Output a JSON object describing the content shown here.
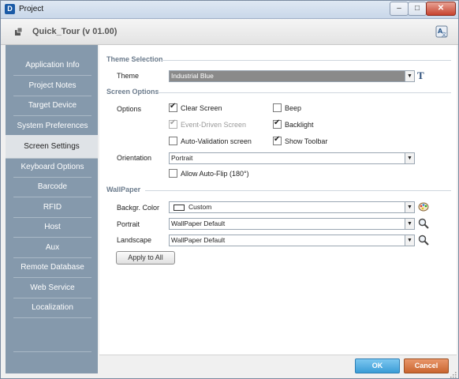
{
  "window": {
    "title": "Project",
    "app_icon_letter": "D",
    "minimize": "–",
    "maximize": "□",
    "close": "✕"
  },
  "header": {
    "project_name": "Quick_Tour (v 01.00)"
  },
  "sidebar": {
    "items": [
      {
        "label": "Application Info"
      },
      {
        "label": "Project Notes"
      },
      {
        "label": "Target Device"
      },
      {
        "label": "System Preferences"
      },
      {
        "label": "Screen Settings",
        "active": true
      },
      {
        "label": "Keyboard Options"
      },
      {
        "label": "Barcode"
      },
      {
        "label": "RFID"
      },
      {
        "label": "Host"
      },
      {
        "label": "Aux"
      },
      {
        "label": "Remote Database"
      },
      {
        "label": "Web Service"
      },
      {
        "label": "Localization"
      }
    ]
  },
  "theme_selection": {
    "section_title": "Theme Selection",
    "theme_label": "Theme",
    "theme_value": "Industrial Blue",
    "font_button_glyph": "T"
  },
  "screen_options": {
    "section_title": "Screen Options",
    "options_label": "Options",
    "checkboxes": {
      "clear_screen": {
        "label": "Clear Screen",
        "checked": true
      },
      "beep": {
        "label": "Beep",
        "checked": false
      },
      "event_driven": {
        "label": "Event-Driven Screen",
        "checked": true,
        "disabled": true
      },
      "backlight": {
        "label": "Backlight",
        "checked": true
      },
      "auto_validation": {
        "label": "Auto-Validation screen",
        "checked": false
      },
      "show_toolbar": {
        "label": "Show Toolbar",
        "checked": true
      },
      "allow_auto_flip": {
        "label": "Allow Auto-Flip (180°)",
        "checked": false
      }
    },
    "orientation_label": "Orientation",
    "orientation_value": "Portrait"
  },
  "wallpaper": {
    "section_title": "WallPaper",
    "backgr_label": "Backgr. Color",
    "backgr_value": "Custom",
    "portrait_label": "Portrait",
    "portrait_value": "WallPaper Default",
    "landscape_label": "Landscape",
    "landscape_value": "WallPaper Default",
    "apply_label": "Apply to All"
  },
  "footer": {
    "ok_label": "OK",
    "cancel_label": "Cancel"
  },
  "colors": {
    "sidebar": "#8599ac",
    "ok": "#3b9cd6",
    "cancel": "#c9652f",
    "section_title": "#6b7b8c"
  }
}
